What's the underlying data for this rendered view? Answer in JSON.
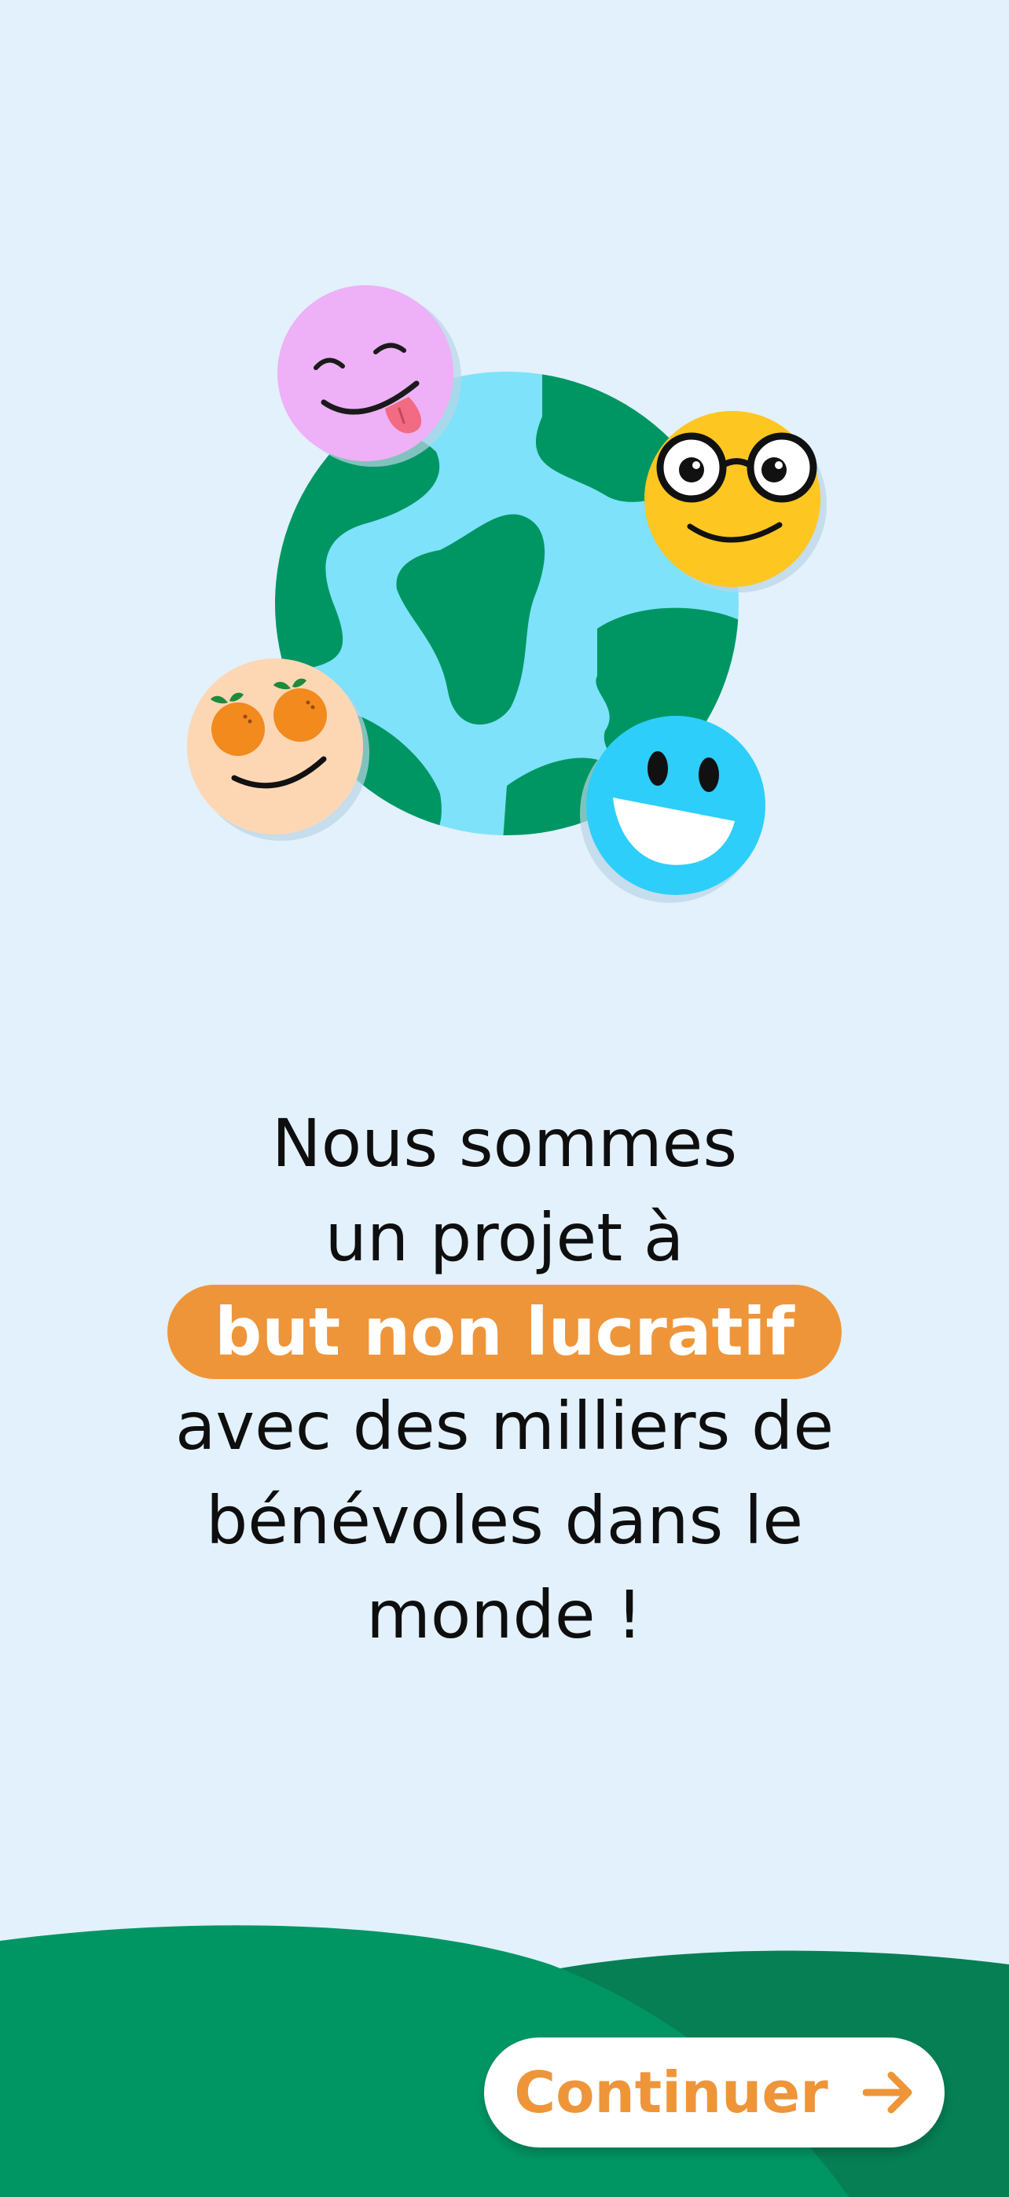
{
  "headline": {
    "line1": "Nous sommes",
    "line2": "un projet à",
    "highlight": "but non lucratif",
    "line4": "avec des milliers de",
    "line5": "bénévoles dans le",
    "line6": "monde !"
  },
  "continue_button": {
    "label": "Continuer",
    "icon": "arrow-right-icon"
  },
  "illustration": {
    "icons": [
      "globe-icon",
      "tongue-out-face-icon",
      "glasses-face-icon",
      "orange-eyes-face-icon",
      "grinning-face-icon"
    ]
  },
  "colors": {
    "background": "#E2F1FB",
    "accent": "#EE953A",
    "hill_light": "#009664",
    "hill_dark": "#067F55",
    "globe_ocean": "#7DE2FA",
    "globe_land": "#009663",
    "text": "#0E0E0E"
  }
}
